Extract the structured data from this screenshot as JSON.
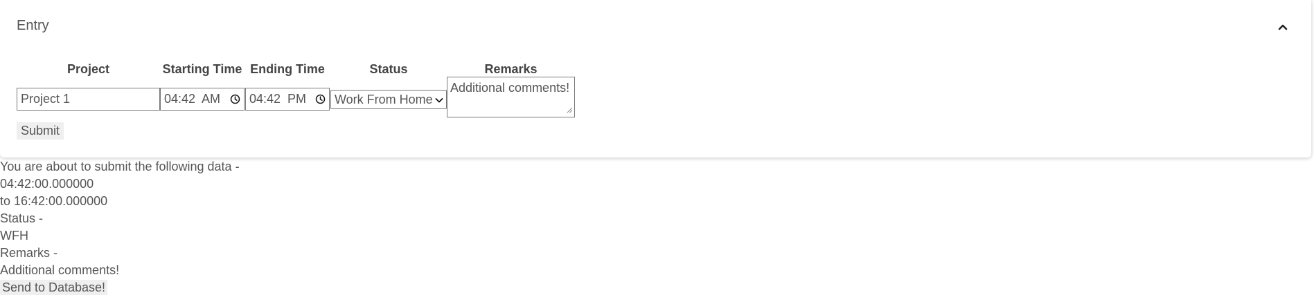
{
  "panel": {
    "title": "Entry",
    "collapse_icon": "chevron-up-icon"
  },
  "form": {
    "headers": {
      "project": "Project",
      "starting_time": "Starting Time",
      "ending_time": "Ending Time",
      "status": "Status",
      "remarks": "Remarks"
    },
    "project_value": "Project 1",
    "starting_time_value": "04:42  AM",
    "ending_time_value": "04:42  PM",
    "status_selected": "Work From Home",
    "remarks_value": "Additional comments!",
    "submit_label": "Submit",
    "time_icon": "clock-icon",
    "select_icon": "chevron-down-icon"
  },
  "summary": {
    "lines": [
      "You are about to submit the following data -",
      "04:42:00.000000",
      "to 16:42:00.000000",
      "Status -",
      "WFH",
      "Remarks -",
      "Additional comments!"
    ],
    "send_label": "Send to Database!"
  }
}
